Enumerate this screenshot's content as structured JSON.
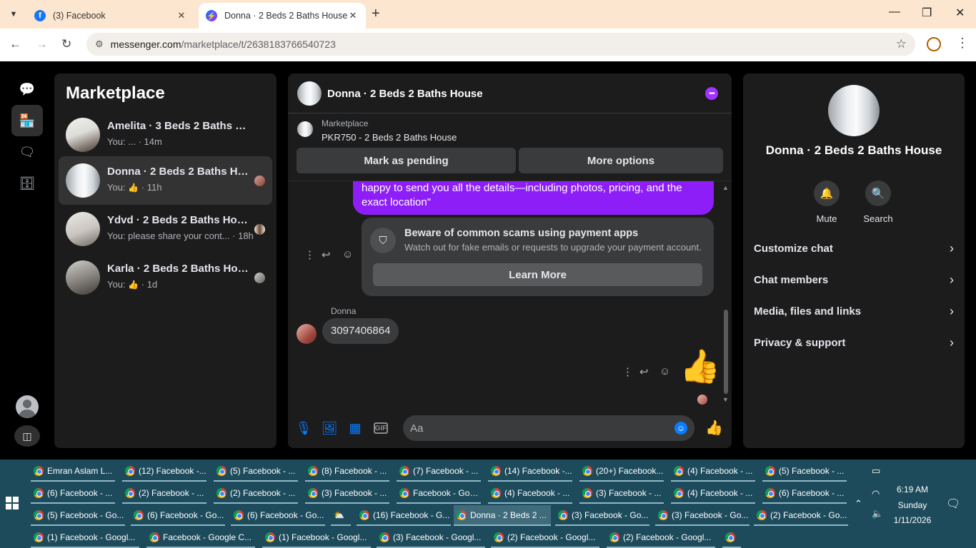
{
  "browser": {
    "tabs": [
      {
        "title": "(3) Facebook",
        "close": "✕"
      },
      {
        "title": "Donna · 2 Beds 2 Baths House |",
        "close": "✕"
      }
    ],
    "new_tab": "+",
    "url_host": "messenger.com",
    "url_path": "/marketplace/t/2638183766540723",
    "window": {
      "minimize": "—",
      "restore": "❐",
      "close": "✕"
    }
  },
  "sidebar": {
    "title": "Marketplace",
    "conversations": [
      {
        "name": "Amelita · 3 Beds 2 Baths H...",
        "preview_prefix": "You: ...",
        "time": " · 14m"
      },
      {
        "name": "Donna · 2 Beds 2 Baths Ho...",
        "preview_prefix": "You:",
        "time": " · 11h"
      },
      {
        "name": "Ydvd · 2 Beds 2 Baths House",
        "preview_prefix": "You: please share your cont...",
        "time": " · 18h"
      },
      {
        "name": "Karla · 2 Beds 2 Baths House",
        "preview_prefix": "You:",
        "time": " · 1d"
      }
    ]
  },
  "chat": {
    "title": "Donna · 2 Beds 2 Baths House",
    "listing_label": "Marketplace",
    "listing_price": "PKR750 - 2 Beds 2 Baths House",
    "mark_pending": "Mark as pending",
    "more_options": "More options",
    "sent_message": "happy to send you all the details—including photos, pricing, and the exact location\"",
    "scam_title": "Beware of common scams using payment apps",
    "scam_body": "Watch out for fake emails or requests to upgrade your payment account.",
    "learn_more": "Learn More",
    "sender": "Donna",
    "received_message": "3097406864",
    "input_placeholder": "Aa"
  },
  "info": {
    "title": "Donna · 2 Beds 2 Baths House",
    "mute": "Mute",
    "search": "Search",
    "rows": [
      "Customize chat",
      "Chat members",
      "Media, files and links",
      "Privacy & support"
    ]
  },
  "taskbar": {
    "row1": [
      "Emran Aslam L...",
      "(12) Facebook -...",
      "(5) Facebook - ...",
      "(8) Facebook - ...",
      "(7) Facebook - ...",
      "(14) Facebook -...",
      "(20+) Facebook...",
      "(4) Facebook - ...",
      "(5) Facebook - ..."
    ],
    "row2": [
      "(6) Facebook - ...",
      "(2) Facebook - ...",
      "(2) Facebook - ...",
      "(3) Facebook - ...",
      "Facebook - Goo...",
      "(4) Facebook - ...",
      "(3) Facebook - ...",
      "(4) Facebook - ...",
      "(6) Facebook - ..."
    ],
    "row3": [
      "(5) Facebook - Go...",
      "(6) Facebook - Go...",
      "(6) Facebook - Go...",
      "",
      "(16) Facebook - G...",
      "Donna · 2 Beds 2 ...",
      "(3) Facebook - Go...",
      "(3) Facebook - Go...",
      "(2) Facebook - Go..."
    ],
    "row4": [
      "(1) Facebook - Googl...",
      "Facebook - Google C...",
      "(1) Facebook - Googl...",
      "(3) Facebook - Googl...",
      "(2) Facebook - Googl...",
      "(2) Facebook - Googl...",
      ""
    ],
    "time": "6:19 AM",
    "day": "Sunday",
    "date": "1/11/2026"
  }
}
